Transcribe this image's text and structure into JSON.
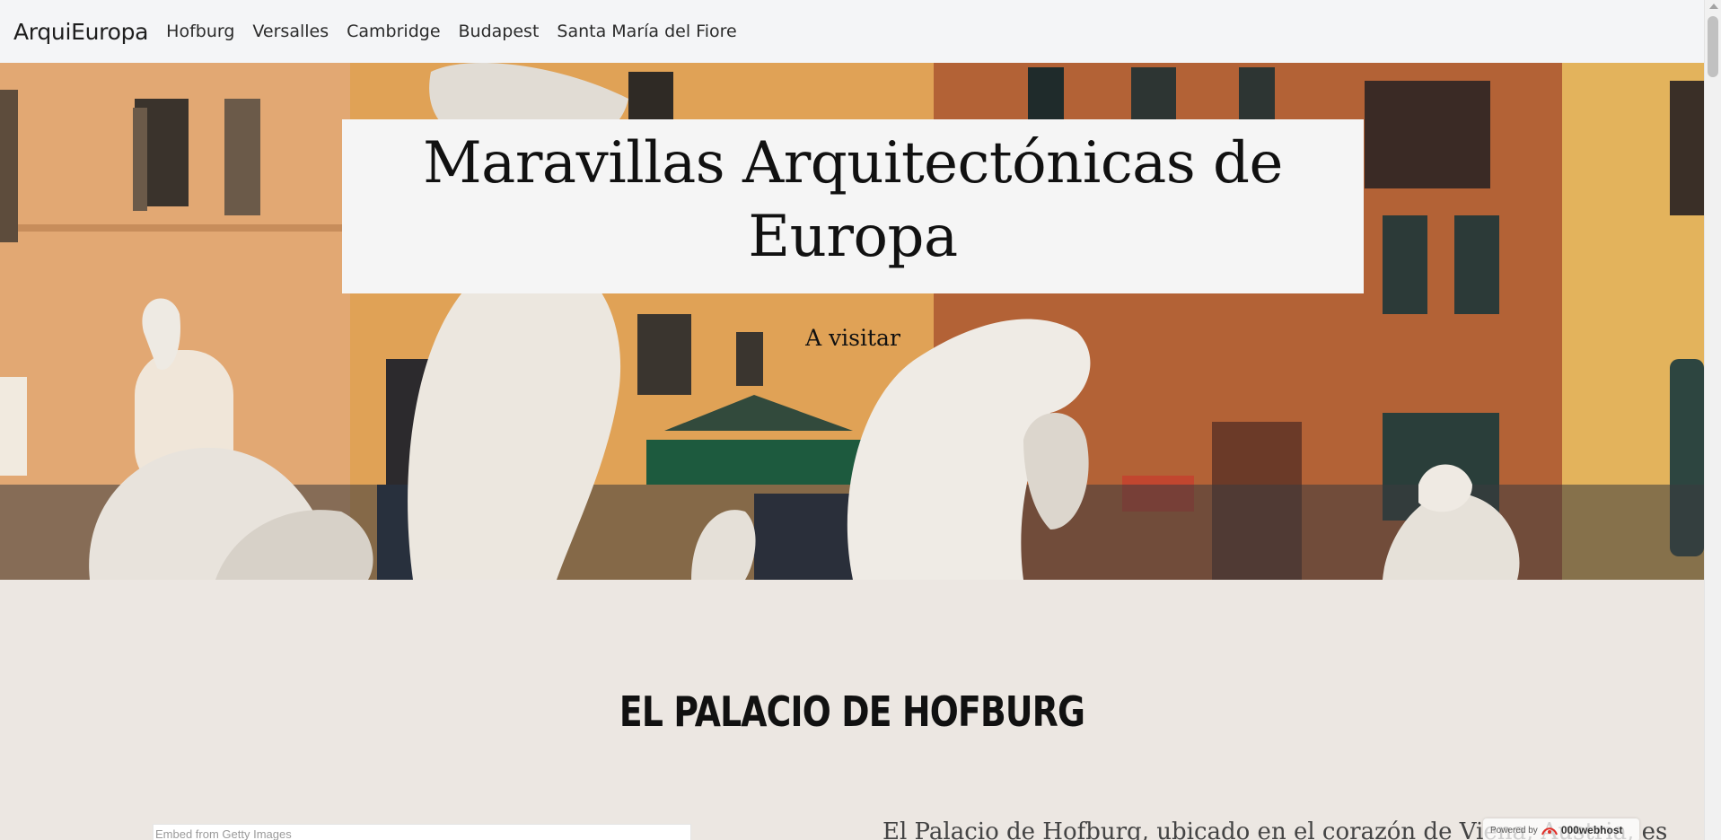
{
  "navbar": {
    "brand": "ArquiEuropa",
    "links": [
      "Hofburg",
      "Versalles",
      "Cambridge",
      "Budapest",
      "Santa María del Fiore"
    ]
  },
  "hero": {
    "title": "Maravillas Arquitectónicas de Europa",
    "subtitle": "A visitar",
    "image_desc": "fountain-sculptures-with-buildings-icon"
  },
  "section": {
    "title": "EL PALACIO DE HOFBURG",
    "embed_label": "Embed from Getty Images",
    "paragraph": "El Palacio de Hofburg, ubicado en el corazón de Viena, Austria, es"
  },
  "badge": {
    "powered_by": "Powered by",
    "brand": "000webhost"
  },
  "colors": {
    "navbar_bg": "#f4f5f7",
    "section_bg": "#ece7e2",
    "hero_box_bg": "#f5f5f5"
  }
}
